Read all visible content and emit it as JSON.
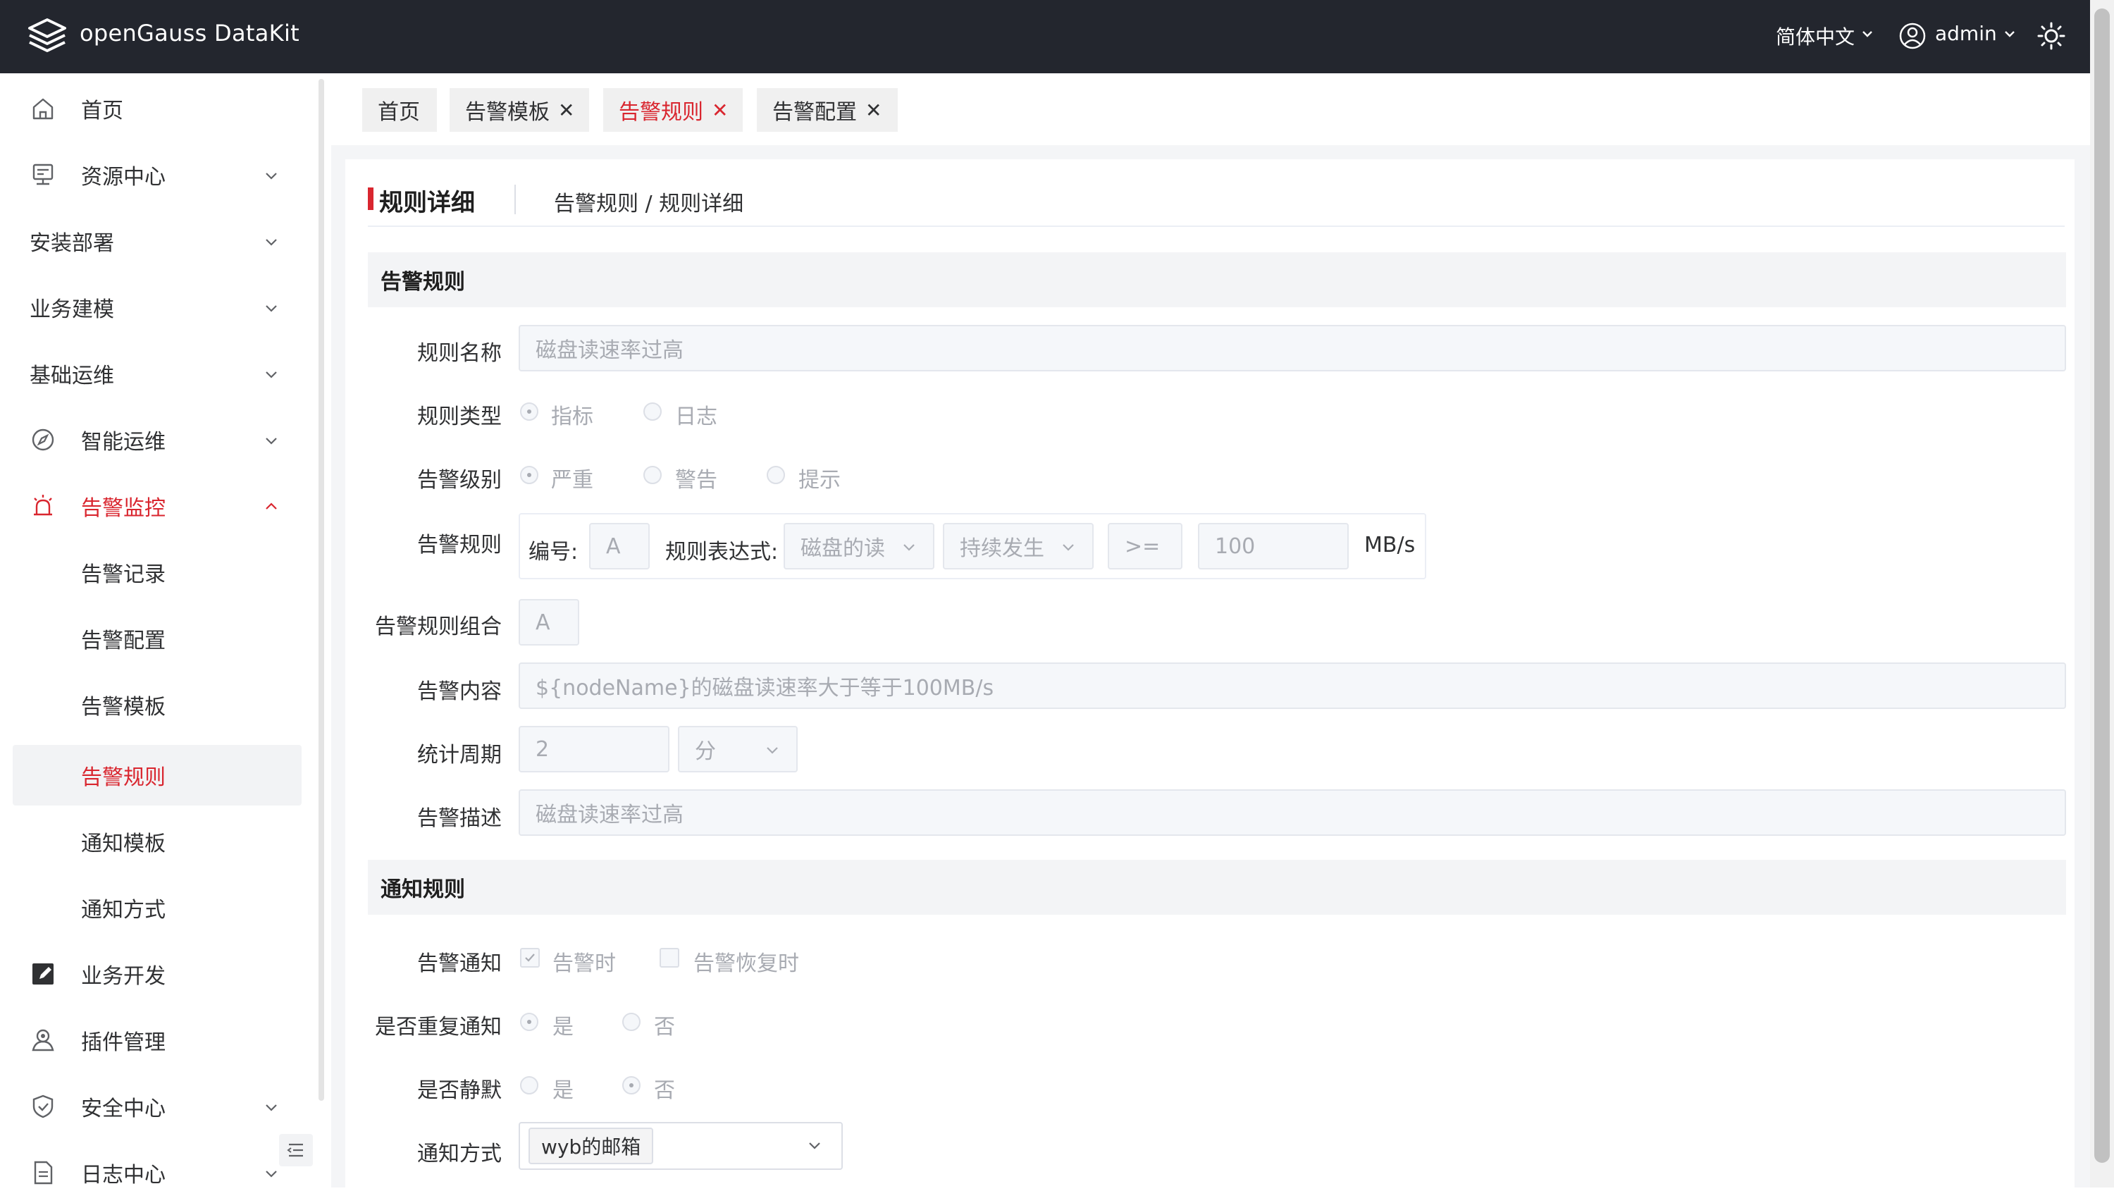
{
  "app": {
    "title": "openGauss DataKit"
  },
  "header": {
    "language": "简体中文",
    "user": "admin"
  },
  "sidebar": {
    "items": [
      {
        "label": "首页",
        "icon": "home-icon"
      },
      {
        "label": "资源中心",
        "icon": "server-icon"
      },
      {
        "label": "安装部署"
      },
      {
        "label": "业务建模"
      },
      {
        "label": "基础运维"
      },
      {
        "label": "智能运维",
        "icon": "compass-icon"
      },
      {
        "label": "告警监控",
        "icon": "alarm-icon"
      },
      {
        "label": "告警记录"
      },
      {
        "label": "告警配置"
      },
      {
        "label": "告警模板"
      },
      {
        "label": "告警规则"
      },
      {
        "label": "通知模板"
      },
      {
        "label": "通知方式"
      },
      {
        "label": "业务开发",
        "icon": "edit-icon"
      },
      {
        "label": "插件管理",
        "icon": "plugin-icon"
      },
      {
        "label": "安全中心",
        "icon": "shield-icon"
      },
      {
        "label": "日志中心",
        "icon": "document-icon"
      }
    ]
  },
  "tabs": [
    {
      "label": "首页"
    },
    {
      "label": "告警模板",
      "close": "✕"
    },
    {
      "label": "告警规则",
      "close": "✕"
    },
    {
      "label": "告警配置",
      "close": "✕"
    }
  ],
  "page": {
    "title": "规则详细",
    "breadcrumb": "告警规则 / 规则详细"
  },
  "form": {
    "section1": "告警规则",
    "rule_name_label": "规则名称",
    "rule_name_value": "磁盘读速率过高",
    "rule_type_label": "规则类型",
    "rule_type_options": [
      "指标",
      "日志"
    ],
    "level_label": "告警级别",
    "level_options": [
      "严重",
      "警告",
      "提示"
    ],
    "rule_label": "告警规则",
    "rule_no_label": "编号:",
    "rule_no_value": "A",
    "rule_expr_label": "规则表达式:",
    "rule_expr_metric": "磁盘的读",
    "rule_expr_duration": "持续发生",
    "rule_expr_op": ">=",
    "rule_expr_value": "100",
    "rule_expr_unit": "MB/s",
    "combo_label": "告警规则组合",
    "combo_value": "A",
    "content_label": "告警内容",
    "content_value": "${nodeName}的磁盘读速率大于等于100MB/s",
    "period_label": "统计周期",
    "period_value": "2",
    "period_unit": "分",
    "desc_label": "告警描述",
    "desc_value": "磁盘读速率过高",
    "section2": "通知规则",
    "notify_label": "告警通知",
    "notify_options": [
      "告警时",
      "告警恢复时"
    ],
    "repeat_label": "是否重复通知",
    "repeat_options": [
      "是",
      "否"
    ],
    "silent_label": "是否静默",
    "silent_options": [
      "是",
      "否"
    ],
    "method_label": "通知方式",
    "method_value": "wyb的邮箱"
  },
  "colors": {
    "accent": "#d9262f",
    "topbar": "#23262e"
  }
}
